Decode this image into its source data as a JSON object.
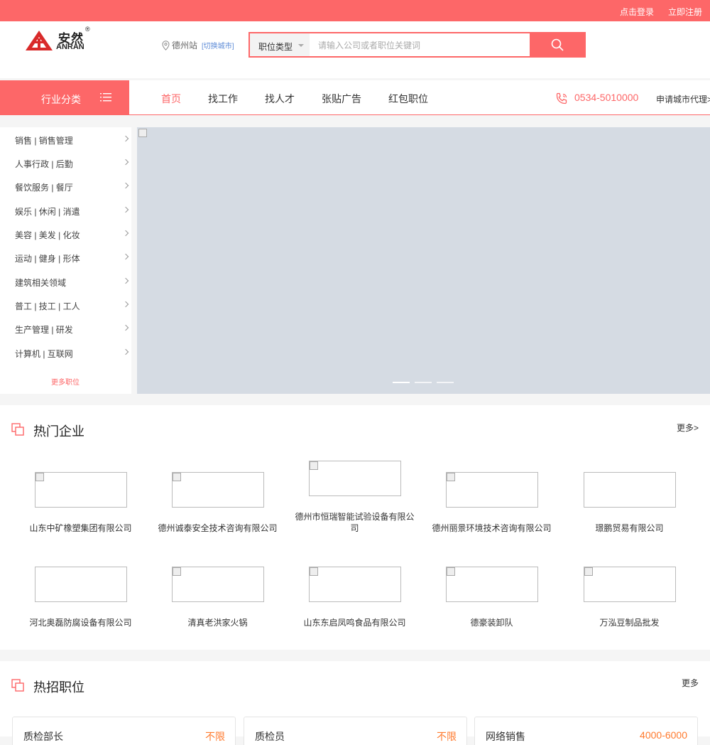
{
  "topbar": {
    "login": "点击登录",
    "register": "立即注册"
  },
  "brand": {
    "cn": "安然",
    "en": "ANRAN",
    "reg": "®",
    "color": "#d92a2a"
  },
  "location": {
    "city": "德州站",
    "switch": "[切换城市]"
  },
  "search": {
    "type": "职位类型",
    "placeholder": "请输入公司或者职位关键词",
    "icon": "search-icon"
  },
  "nav": {
    "category": "行业分类",
    "items": [
      "首页",
      "找工作",
      "找人才",
      "张贴广告",
      "红包职位"
    ],
    "phone": "0534-5010000",
    "agent": "申请城市代理>"
  },
  "sidebar": {
    "items": [
      "销售 | 销售管理",
      "人事行政 | 后勤",
      "餐饮服务 | 餐厅",
      "娱乐 | 休闲 | 消遣",
      "美容 | 美发 | 化妆",
      "运动 | 健身 | 形体",
      "建筑相关领域",
      "普工 | 技工 | 工人",
      "生产管理 | 研发",
      "计算机 | 互联网"
    ],
    "more": "更多职位"
  },
  "hot_companies": {
    "title": "热门企业",
    "more": "更多>",
    "companies": [
      "山东中矿橡塑集团有限公司",
      "德州诚泰安全技术咨询有限公司",
      "德州市恒瑞智能试验设备有限公司",
      "德州丽景环境技术咨询有限公司",
      "璟鹏贸易有限公司",
      "河北奥磊防腐设备有限公司",
      "清真老洪家火锅",
      "山东东启凤鸣食品有限公司",
      "德豪装卸队",
      "万泓豆制品批发"
    ]
  },
  "hot_jobs": {
    "title": "热招职位",
    "more": "更多",
    "jobs": [
      {
        "title": "质检部长",
        "salary": "不限"
      },
      {
        "title": "质检员",
        "salary": "不限"
      },
      {
        "title": "网络销售",
        "salary": "4000-6000"
      }
    ]
  },
  "colors": {
    "accent": "#fd6768",
    "salary": "#ff7a2e",
    "link": "#5b8ad6"
  }
}
